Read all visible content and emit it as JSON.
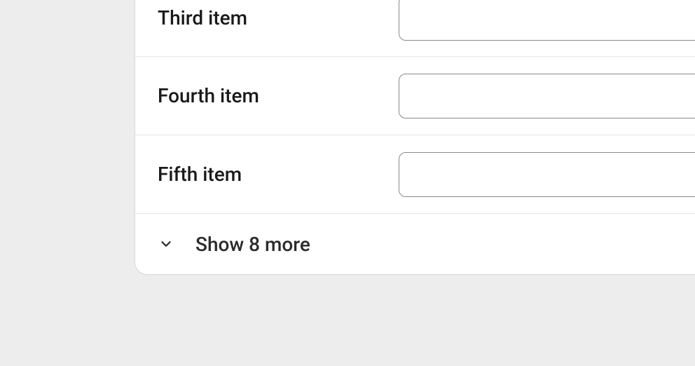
{
  "rows": [
    {
      "label": "Third item",
      "value": ""
    },
    {
      "label": "Fourth item",
      "value": ""
    },
    {
      "label": "Fifth item",
      "value": ""
    }
  ],
  "show_more": {
    "label": "Show 8 more"
  }
}
